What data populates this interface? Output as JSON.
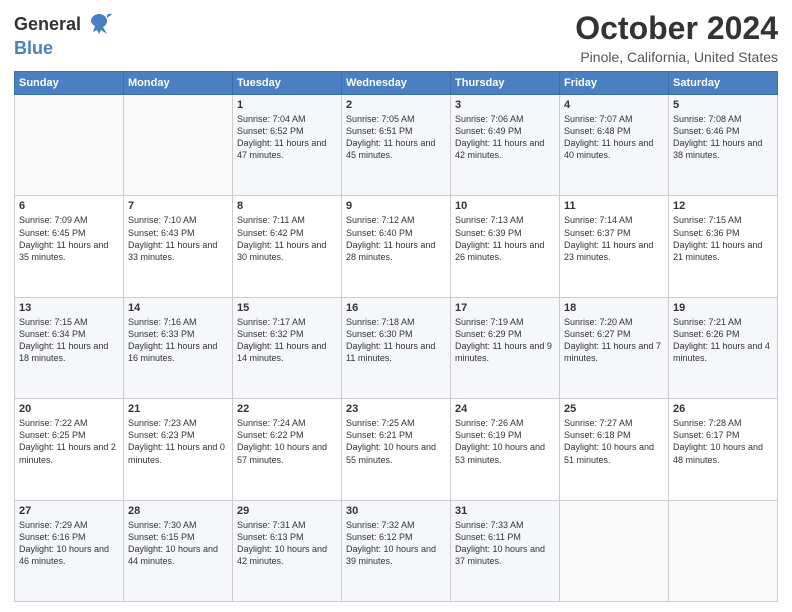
{
  "logo": {
    "general": "General",
    "blue": "Blue"
  },
  "header": {
    "title": "October 2024",
    "subtitle": "Pinole, California, United States"
  },
  "weekdays": [
    "Sunday",
    "Monday",
    "Tuesday",
    "Wednesday",
    "Thursday",
    "Friday",
    "Saturday"
  ],
  "weeks": [
    [
      {
        "day": "",
        "info": ""
      },
      {
        "day": "",
        "info": ""
      },
      {
        "day": "1",
        "info": "Sunrise: 7:04 AM\nSunset: 6:52 PM\nDaylight: 11 hours and 47 minutes."
      },
      {
        "day": "2",
        "info": "Sunrise: 7:05 AM\nSunset: 6:51 PM\nDaylight: 11 hours and 45 minutes."
      },
      {
        "day": "3",
        "info": "Sunrise: 7:06 AM\nSunset: 6:49 PM\nDaylight: 11 hours and 42 minutes."
      },
      {
        "day": "4",
        "info": "Sunrise: 7:07 AM\nSunset: 6:48 PM\nDaylight: 11 hours and 40 minutes."
      },
      {
        "day": "5",
        "info": "Sunrise: 7:08 AM\nSunset: 6:46 PM\nDaylight: 11 hours and 38 minutes."
      }
    ],
    [
      {
        "day": "6",
        "info": "Sunrise: 7:09 AM\nSunset: 6:45 PM\nDaylight: 11 hours and 35 minutes."
      },
      {
        "day": "7",
        "info": "Sunrise: 7:10 AM\nSunset: 6:43 PM\nDaylight: 11 hours and 33 minutes."
      },
      {
        "day": "8",
        "info": "Sunrise: 7:11 AM\nSunset: 6:42 PM\nDaylight: 11 hours and 30 minutes."
      },
      {
        "day": "9",
        "info": "Sunrise: 7:12 AM\nSunset: 6:40 PM\nDaylight: 11 hours and 28 minutes."
      },
      {
        "day": "10",
        "info": "Sunrise: 7:13 AM\nSunset: 6:39 PM\nDaylight: 11 hours and 26 minutes."
      },
      {
        "day": "11",
        "info": "Sunrise: 7:14 AM\nSunset: 6:37 PM\nDaylight: 11 hours and 23 minutes."
      },
      {
        "day": "12",
        "info": "Sunrise: 7:15 AM\nSunset: 6:36 PM\nDaylight: 11 hours and 21 minutes."
      }
    ],
    [
      {
        "day": "13",
        "info": "Sunrise: 7:15 AM\nSunset: 6:34 PM\nDaylight: 11 hours and 18 minutes."
      },
      {
        "day": "14",
        "info": "Sunrise: 7:16 AM\nSunset: 6:33 PM\nDaylight: 11 hours and 16 minutes."
      },
      {
        "day": "15",
        "info": "Sunrise: 7:17 AM\nSunset: 6:32 PM\nDaylight: 11 hours and 14 minutes."
      },
      {
        "day": "16",
        "info": "Sunrise: 7:18 AM\nSunset: 6:30 PM\nDaylight: 11 hours and 11 minutes."
      },
      {
        "day": "17",
        "info": "Sunrise: 7:19 AM\nSunset: 6:29 PM\nDaylight: 11 hours and 9 minutes."
      },
      {
        "day": "18",
        "info": "Sunrise: 7:20 AM\nSunset: 6:27 PM\nDaylight: 11 hours and 7 minutes."
      },
      {
        "day": "19",
        "info": "Sunrise: 7:21 AM\nSunset: 6:26 PM\nDaylight: 11 hours and 4 minutes."
      }
    ],
    [
      {
        "day": "20",
        "info": "Sunrise: 7:22 AM\nSunset: 6:25 PM\nDaylight: 11 hours and 2 minutes."
      },
      {
        "day": "21",
        "info": "Sunrise: 7:23 AM\nSunset: 6:23 PM\nDaylight: 11 hours and 0 minutes."
      },
      {
        "day": "22",
        "info": "Sunrise: 7:24 AM\nSunset: 6:22 PM\nDaylight: 10 hours and 57 minutes."
      },
      {
        "day": "23",
        "info": "Sunrise: 7:25 AM\nSunset: 6:21 PM\nDaylight: 10 hours and 55 minutes."
      },
      {
        "day": "24",
        "info": "Sunrise: 7:26 AM\nSunset: 6:19 PM\nDaylight: 10 hours and 53 minutes."
      },
      {
        "day": "25",
        "info": "Sunrise: 7:27 AM\nSunset: 6:18 PM\nDaylight: 10 hours and 51 minutes."
      },
      {
        "day": "26",
        "info": "Sunrise: 7:28 AM\nSunset: 6:17 PM\nDaylight: 10 hours and 48 minutes."
      }
    ],
    [
      {
        "day": "27",
        "info": "Sunrise: 7:29 AM\nSunset: 6:16 PM\nDaylight: 10 hours and 46 minutes."
      },
      {
        "day": "28",
        "info": "Sunrise: 7:30 AM\nSunset: 6:15 PM\nDaylight: 10 hours and 44 minutes."
      },
      {
        "day": "29",
        "info": "Sunrise: 7:31 AM\nSunset: 6:13 PM\nDaylight: 10 hours and 42 minutes."
      },
      {
        "day": "30",
        "info": "Sunrise: 7:32 AM\nSunset: 6:12 PM\nDaylight: 10 hours and 39 minutes."
      },
      {
        "day": "31",
        "info": "Sunrise: 7:33 AM\nSunset: 6:11 PM\nDaylight: 10 hours and 37 minutes."
      },
      {
        "day": "",
        "info": ""
      },
      {
        "day": "",
        "info": ""
      }
    ]
  ]
}
